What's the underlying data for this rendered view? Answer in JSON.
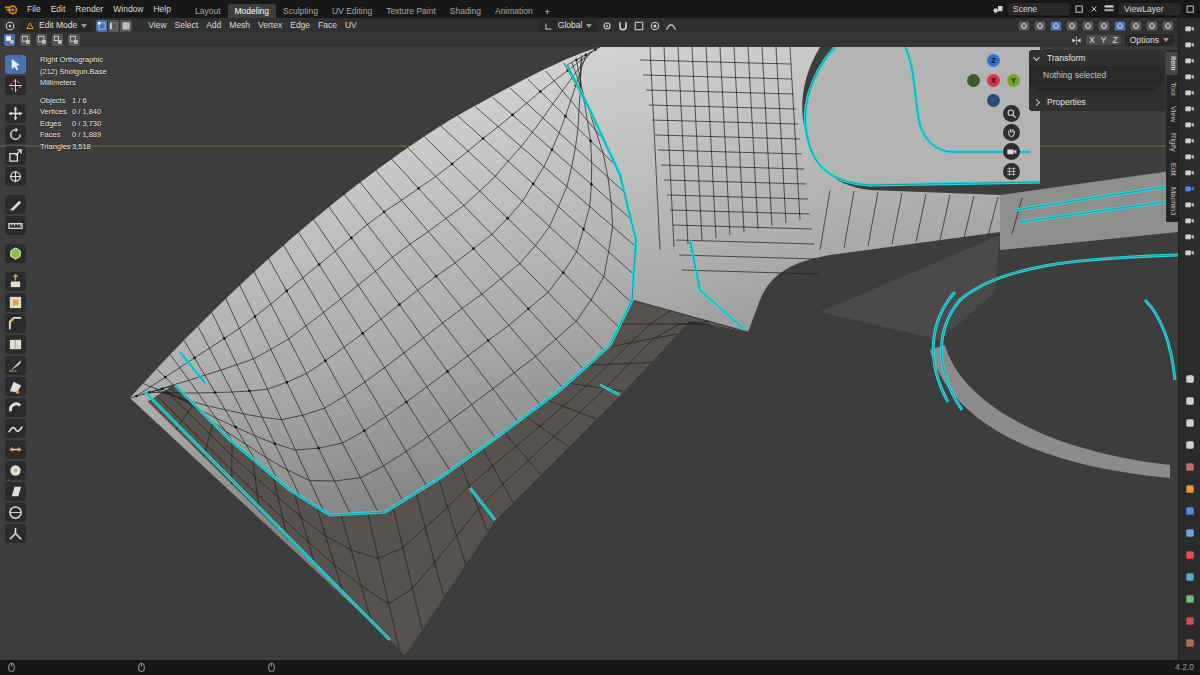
{
  "topbar": {
    "menus": [
      "File",
      "Edit",
      "Render",
      "Window",
      "Help"
    ],
    "workspaces": [
      {
        "label": "Layout",
        "selected": false
      },
      {
        "label": "Modeling",
        "selected": true
      },
      {
        "label": "Sculpting",
        "selected": false
      },
      {
        "label": "UV Editing",
        "selected": false
      },
      {
        "label": "Texture Paint",
        "selected": false
      },
      {
        "label": "Shading",
        "selected": false
      },
      {
        "label": "Animation",
        "selected": false
      }
    ],
    "add_workspace": "+",
    "scene": "Scene",
    "view_layer": "ViewLayer"
  },
  "header": {
    "mode": "Edit Mode",
    "select_modes": [
      {
        "selected": true
      },
      {
        "selected": false
      },
      {
        "selected": false
      }
    ],
    "menus": [
      "View",
      "Select",
      "Add",
      "Mesh",
      "Vertex",
      "Edge",
      "Face",
      "UV"
    ],
    "orientation": "Global"
  },
  "tool_header": {
    "box_modes": [
      {
        "selected": true
      },
      {
        "selected": false
      },
      {
        "selected": false
      },
      {
        "selected": false
      },
      {
        "selected": false
      }
    ],
    "mirror_axes": [
      {
        "label": "X",
        "selected": false
      },
      {
        "label": "Y",
        "selected": false
      },
      {
        "label": "Z",
        "selected": false
      }
    ],
    "options": "Options"
  },
  "toolbar": {
    "tools": [
      {
        "selected": true
      },
      {
        "selected": false
      },
      {
        "selected": false
      },
      {
        "selected": false
      },
      {
        "selected": false
      },
      {
        "selected": false
      },
      {
        "selected": false
      },
      {
        "selected": false
      },
      {
        "selected": false
      },
      {
        "selected": false
      },
      {
        "selected": false
      },
      {
        "selected": false
      },
      {
        "selected": false
      },
      {
        "selected": false
      },
      {
        "selected": false
      },
      {
        "selected": false
      },
      {
        "selected": false
      },
      {
        "selected": false
      },
      {
        "selected": false
      },
      {
        "selected": false
      },
      {
        "selected": false
      },
      {
        "selected": false
      }
    ]
  },
  "overlay": {
    "view": "Right Orthographic",
    "object": "(212) Shotgun.Base",
    "units": "Millimeters",
    "stats": [
      {
        "label": "Objects",
        "value": "1 / 6"
      },
      {
        "label": "Vertices",
        "value": "0 / 1,840"
      },
      {
        "label": "Edges",
        "value": "0 / 3,730"
      },
      {
        "label": "Faces",
        "value": "0 / 1,889"
      },
      {
        "label": "Triangles",
        "value": "3,518"
      }
    ]
  },
  "gizmo": {
    "axes": [
      {
        "label": "Z",
        "color": "#2f6fd6"
      },
      {
        "label": "X",
        "color": "#dc3548"
      },
      {
        "label": "Y",
        "color": "#6fa81f"
      }
    ]
  },
  "sidebar": {
    "transform": {
      "title": "Transform",
      "expanded": true,
      "message": "Nothing selected"
    },
    "properties": {
      "title": "Properties",
      "expanded": false
    },
    "tabs": [
      {
        "label": "Item",
        "selected": true
      },
      {
        "label": "Tool",
        "selected": false
      },
      {
        "label": "View",
        "selected": false
      },
      {
        "label": "Rigify",
        "selected": false
      },
      {
        "label": "Edit",
        "selected": false
      },
      {
        "label": "Machin3",
        "selected": false
      }
    ]
  },
  "status_bar": {
    "version": "4.2.0"
  }
}
